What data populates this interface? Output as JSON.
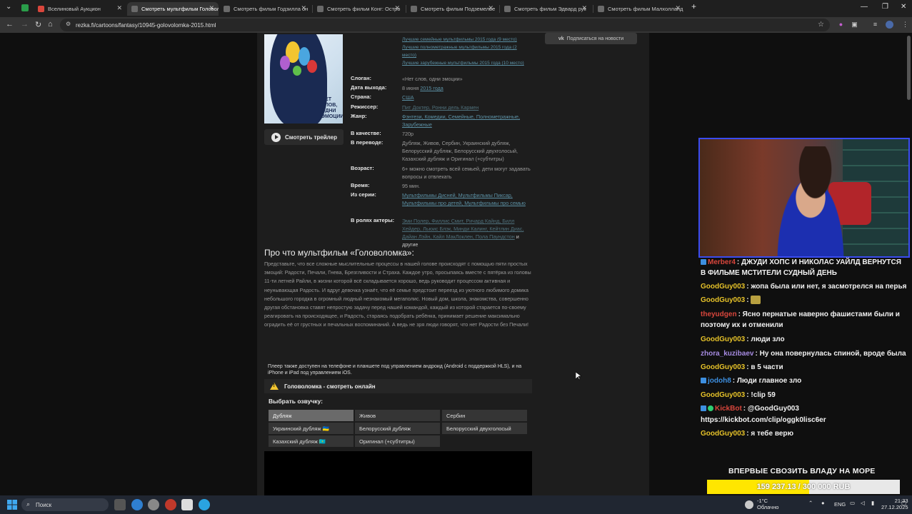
{
  "browser": {
    "tabs": [
      {
        "title": "Вселиновый Аукцион",
        "active": false
      },
      {
        "title": "Смотреть мультфильм Головол",
        "active": true
      },
      {
        "title": "Смотреть фильм Годзилла он",
        "active": false
      },
      {
        "title": "Смотреть фильм Конг: Остро",
        "active": false
      },
      {
        "title": "Смотреть фильм Подземелье",
        "active": false
      },
      {
        "title": "Смотреть фильм Эдвард рук",
        "active": false
      },
      {
        "title": "Смотреть фильм Малхолланд",
        "active": false
      }
    ],
    "url": "rezka.fi/cartoons/fantasy/10945-golovolomka-2015.html"
  },
  "movie": {
    "lists": [
      "Лучшие семейные мультфильмы 2015 года (9 место)",
      "Лучшие полнометражные мультфильмы 2015 года (2 место)",
      "Лучшие зарубежные мультфильмы 2015 года (10 место)"
    ],
    "slogan_label": "Слоган:",
    "slogan": "«Нет слов, одни эмоции»",
    "release_label": "Дата выхода:",
    "release_date": "8 июня",
    "release_year": "2015 года",
    "country_label": "Страна:",
    "country": "США",
    "director_label": "Режиссер:",
    "directors": "Пит Доктер, Ронни дель Кармен",
    "genre_label": "Жанр:",
    "genres": "Фэнтези, Комедии, Семейные, Полнометражные, Зарубежные",
    "quality_label": "В качестве:",
    "quality": "720p",
    "translation_label": "В переводе:",
    "translation": "Дубляж, Живов, Сербин, Украинский дубляж, Белорусский дубляж, Белорусский двухголосый, Казахский дубляж и Оригинал (+субтитры)",
    "age_label": "Возраст:",
    "age": "6+ можно смотреть всей семьей, дети могут задавать вопросы и отвлекать",
    "time_label": "Время:",
    "time": "95 мин.",
    "series_label": "Из серии:",
    "series": "Мультфильмы Дисней, Мультфильмы Пиксар, Мультфильмы про детей, Мультфильмы про семью",
    "cast_label": "В ролях актеры:",
    "cast": "Эми Полер, Филлис Смит, Ричард Кайнд, Билл Хейдер, Льюис Блэк, Минди Калинг, Кейтлин Диас, Дайан Лэйн, Кайл МакЛоклен, Пола Паундстон",
    "cast_more": "и другие",
    "trailer_button": "Смотреть трейлер",
    "subscribe_button": "Подписаться на новости",
    "poster_text": "НЕТ СЛОВ, ОДНИ ЭМОЦИИ"
  },
  "about": {
    "title": "Про что мультфильм «Головоломка»:",
    "text": "Представьте, что все сложные мыслительные процессы в нашей голове происходят с помощью пяти простых эмоций: Радости, Печали, Гнева, Брезгливости и Страха. Каждое утро, просыпаясь вместе с пятёрка из головы 11-ти летней Райли, в жизни которой всё складывается хорошо, ведь руководит процессом активная и неунывающая Радость. И вдруг девочка узнаёт, что её семье предстоит переезд из уютного любимого домика небольшого городка в огромный людный незнакомый мегаполис. Новый дом, школа, знакомства, совершенно другая обстановка ставят непростую задачу перед нашей командой, каждый из которой старается по-своему реагировать на происходящее, и Радость, стараясь подобрать ребёнка, принимает решение максимально оградить её от грустных и печальных воспоминаний. А ведь не зря люди говорят, что нет Радости без Печали!"
  },
  "player": {
    "note": "Плеер также доступен на телефоне и планшете под управлением андроид (Android с поддержкой HLS), и на iPhone и iPad под управлением iOS.",
    "header": "Головоломка - смотреть онлайн",
    "dub_label": "Выбрать озвучку:",
    "dubs": [
      "Дубляж",
      "Живов",
      "Сербин",
      "Украинский дубляж 🇺🇦",
      "Белорусский дубляж",
      "Белорусский двухголосый",
      "Казахский дубляж 🇰🇿",
      "Оригинал (+субтитры)"
    ],
    "selected_dub": "Дубляж"
  },
  "chat": [
    {
      "nick": "Merber4",
      "color": "#d9463c",
      "text": ": ДЖУДИ ХОПС И НИКОЛАС УАЙЛД ВЕРНУТСЯ"
    },
    {
      "nick": "",
      "color": "#f2f2f2",
      "text": "В ФИЛЬМЕ МСТИТЕЛИ СУДНЫЙ ДЕНЬ"
    },
    {
      "nick": "GoodGuy003",
      "color": "#e6c229",
      "text": ": жопа была или нет, я засмотрелся на перья"
    },
    {
      "nick": "GoodGuy003",
      "color": "#e6c229",
      "text": ":"
    },
    {
      "nick": "theyudgen",
      "color": "#d9463c",
      "text": ": Ясно пернатые наверно фашистами были и"
    },
    {
      "nick": "",
      "color": "#f2f2f2",
      "text": "поэтому их и отменили"
    },
    {
      "nick": "GoodGuy003",
      "color": "#e6c229",
      "text": ": люди зло"
    },
    {
      "nick": "zhora_kuzibaev",
      "color": "#a58ae0",
      "text": ": Ну она повернулась спиной, вроде была"
    },
    {
      "nick": "GoodGuy003",
      "color": "#e6c229",
      "text": ": в 5 части"
    },
    {
      "nick": "jodoh8",
      "color": "#3d8fe0",
      "text": ": Люди главное зло"
    },
    {
      "nick": "GoodGuy003",
      "color": "#e6c229",
      "text": ": !clip 59"
    },
    {
      "nick": "KickBot",
      "color": "#d9463c",
      "text": ": @GoodGuy003"
    },
    {
      "nick": "",
      "color": "#f2f2f2",
      "text": "https://kickbot.com/clip/oggk0lisc6er"
    },
    {
      "nick": "GoodGuy003",
      "color": "#e6c229",
      "text": ": я тебе верю"
    }
  ],
  "donation_goal": {
    "title": "ВПЕРВЫЕ СВОЗИТЬ ВЛАДУ НА МОРЕ",
    "text": "159 237.13 / 300 000 RUB",
    "current": 159237.13,
    "target": 300000
  },
  "taskbar": {
    "search_placeholder": "Поиск",
    "weather_temp": "-1°C",
    "weather_text": "Облачно",
    "lang": "ENG",
    "time": "21:33",
    "date": "27.12.2025"
  }
}
